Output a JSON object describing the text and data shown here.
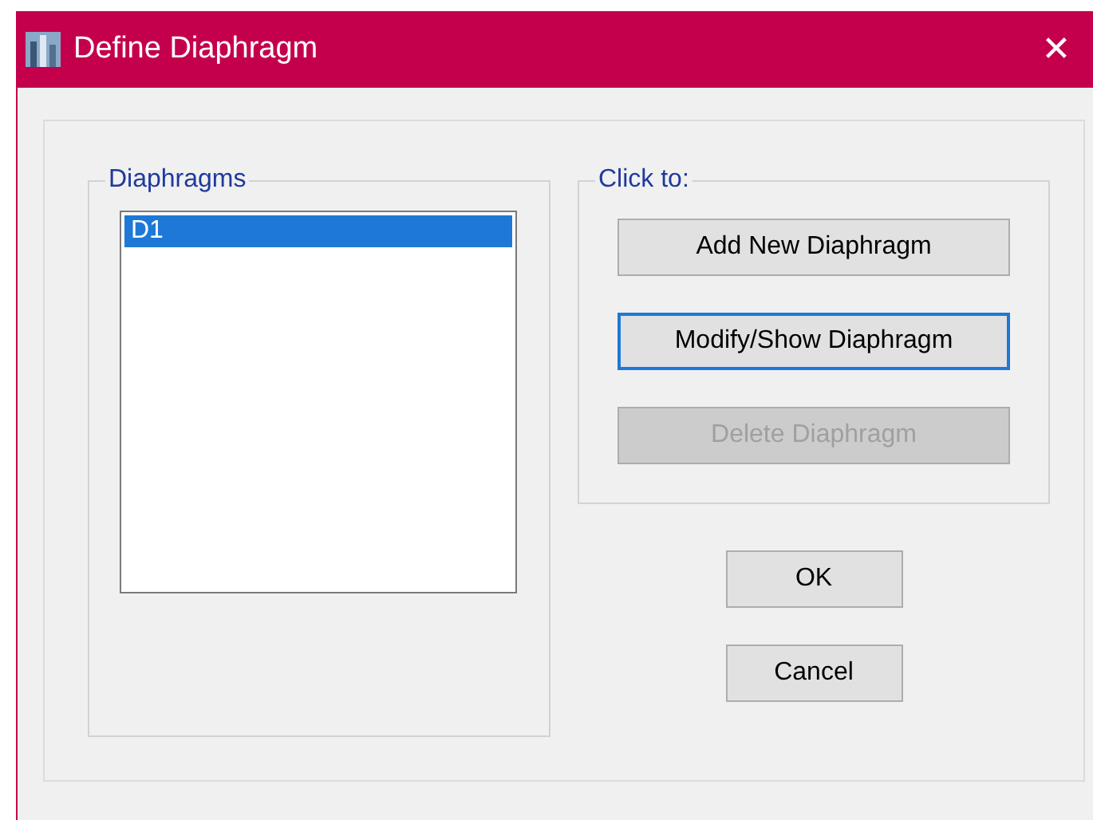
{
  "window": {
    "title": "Define Diaphragm",
    "close": "✕"
  },
  "diaphragms": {
    "legend": "Diaphragms",
    "items": [
      {
        "label": "D1",
        "selected": true
      }
    ]
  },
  "click_to": {
    "legend": "Click to:",
    "buttons": [
      {
        "label": "Add New Diaphragm",
        "focused": false,
        "disabled": false
      },
      {
        "label": "Modify/Show Diaphragm",
        "focused": true,
        "disabled": false
      },
      {
        "label": "Delete Diaphragm",
        "focused": false,
        "disabled": true
      }
    ]
  },
  "dialog_buttons": [
    {
      "label": "OK"
    },
    {
      "label": "Cancel"
    }
  ]
}
